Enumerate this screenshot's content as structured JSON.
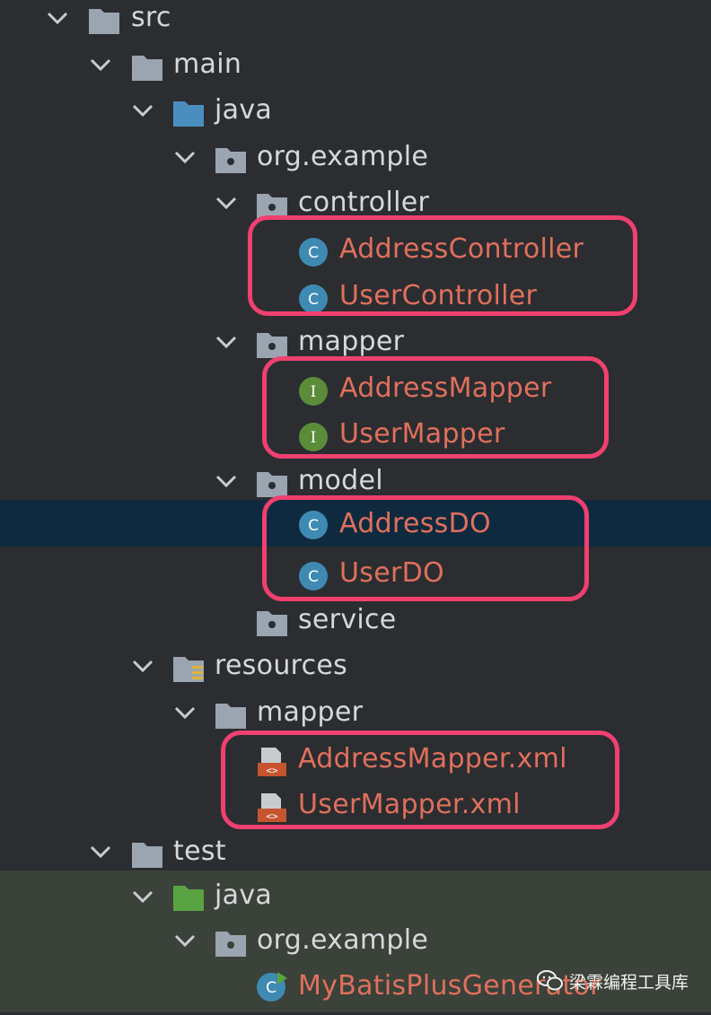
{
  "tree": {
    "src": "src",
    "main": "main",
    "main_java": "java",
    "main_pkg": "org.example",
    "controller": "controller",
    "address_controller": "AddressController",
    "user_controller": "UserController",
    "mapper_pkg": "mapper",
    "address_mapper": "AddressMapper",
    "user_mapper": "UserMapper",
    "model": "model",
    "address_do": "AddressDO",
    "user_do": "UserDO",
    "service": "service",
    "resources": "resources",
    "res_mapper": "mapper",
    "address_mapper_xml": "AddressMapper.xml",
    "user_mapper_xml": "UserMapper.xml",
    "test": "test",
    "test_java": "java",
    "test_pkg": "org.example",
    "generator": "MyBatisPlusGenerator"
  },
  "icons": {
    "class_letter": "C",
    "interface_letter": "I",
    "xml_tag": "<>"
  },
  "watermark": {
    "text": "梁霖编程工具库"
  },
  "colors": {
    "background": "#2b2d30",
    "selection": "#0f2a3f",
    "test_source_bg": "#3a4239",
    "modified_text": "#e0705d",
    "highlight_border": "#f0406f",
    "class_icon": "#3f8ab3",
    "interface_icon": "#5b8c3a",
    "folder": "#9aa5b1",
    "source_folder": "#4a8ec0",
    "test_folder": "#5aa343",
    "xml_icon": "#c6552f"
  }
}
